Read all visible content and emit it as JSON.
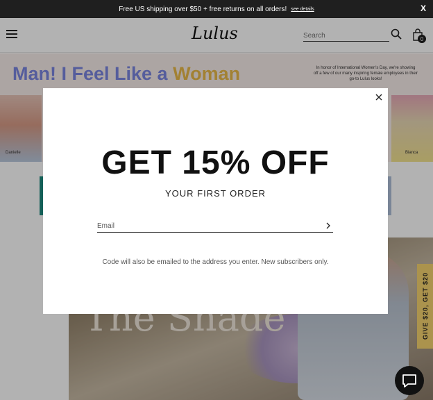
{
  "announcement": {
    "text": "Free US shipping over $50 + free returns on all orders!",
    "link": "see details",
    "close": "X"
  },
  "header": {
    "logo": "Lulus",
    "search_placeholder": "Search",
    "bag_count": "0"
  },
  "banner": {
    "title_part1": "Man! I Feel Like a ",
    "title_part2": "Woman",
    "subtitle": "In honor of International Women's Day, we're showing off a few of our many inspiring female employees in their go-to Lulus looks!",
    "left_name": "Danielle",
    "right_name": "Bianca"
  },
  "hero": {
    "text": "The Shade"
  },
  "side_tab": {
    "label": "GIVE $20, GET $20"
  },
  "modal": {
    "title": "GET 15% OFF",
    "subtitle": "YOUR FIRST ORDER",
    "email_placeholder": "Email",
    "note": "Code will also be emailed to the address you enter. New subscribers only."
  },
  "colors": {
    "topbar": "#1f1f1f",
    "banner_title": "#7a86e0",
    "banner_accent": "#e8b94a",
    "side_tab": "#f5d36f"
  }
}
